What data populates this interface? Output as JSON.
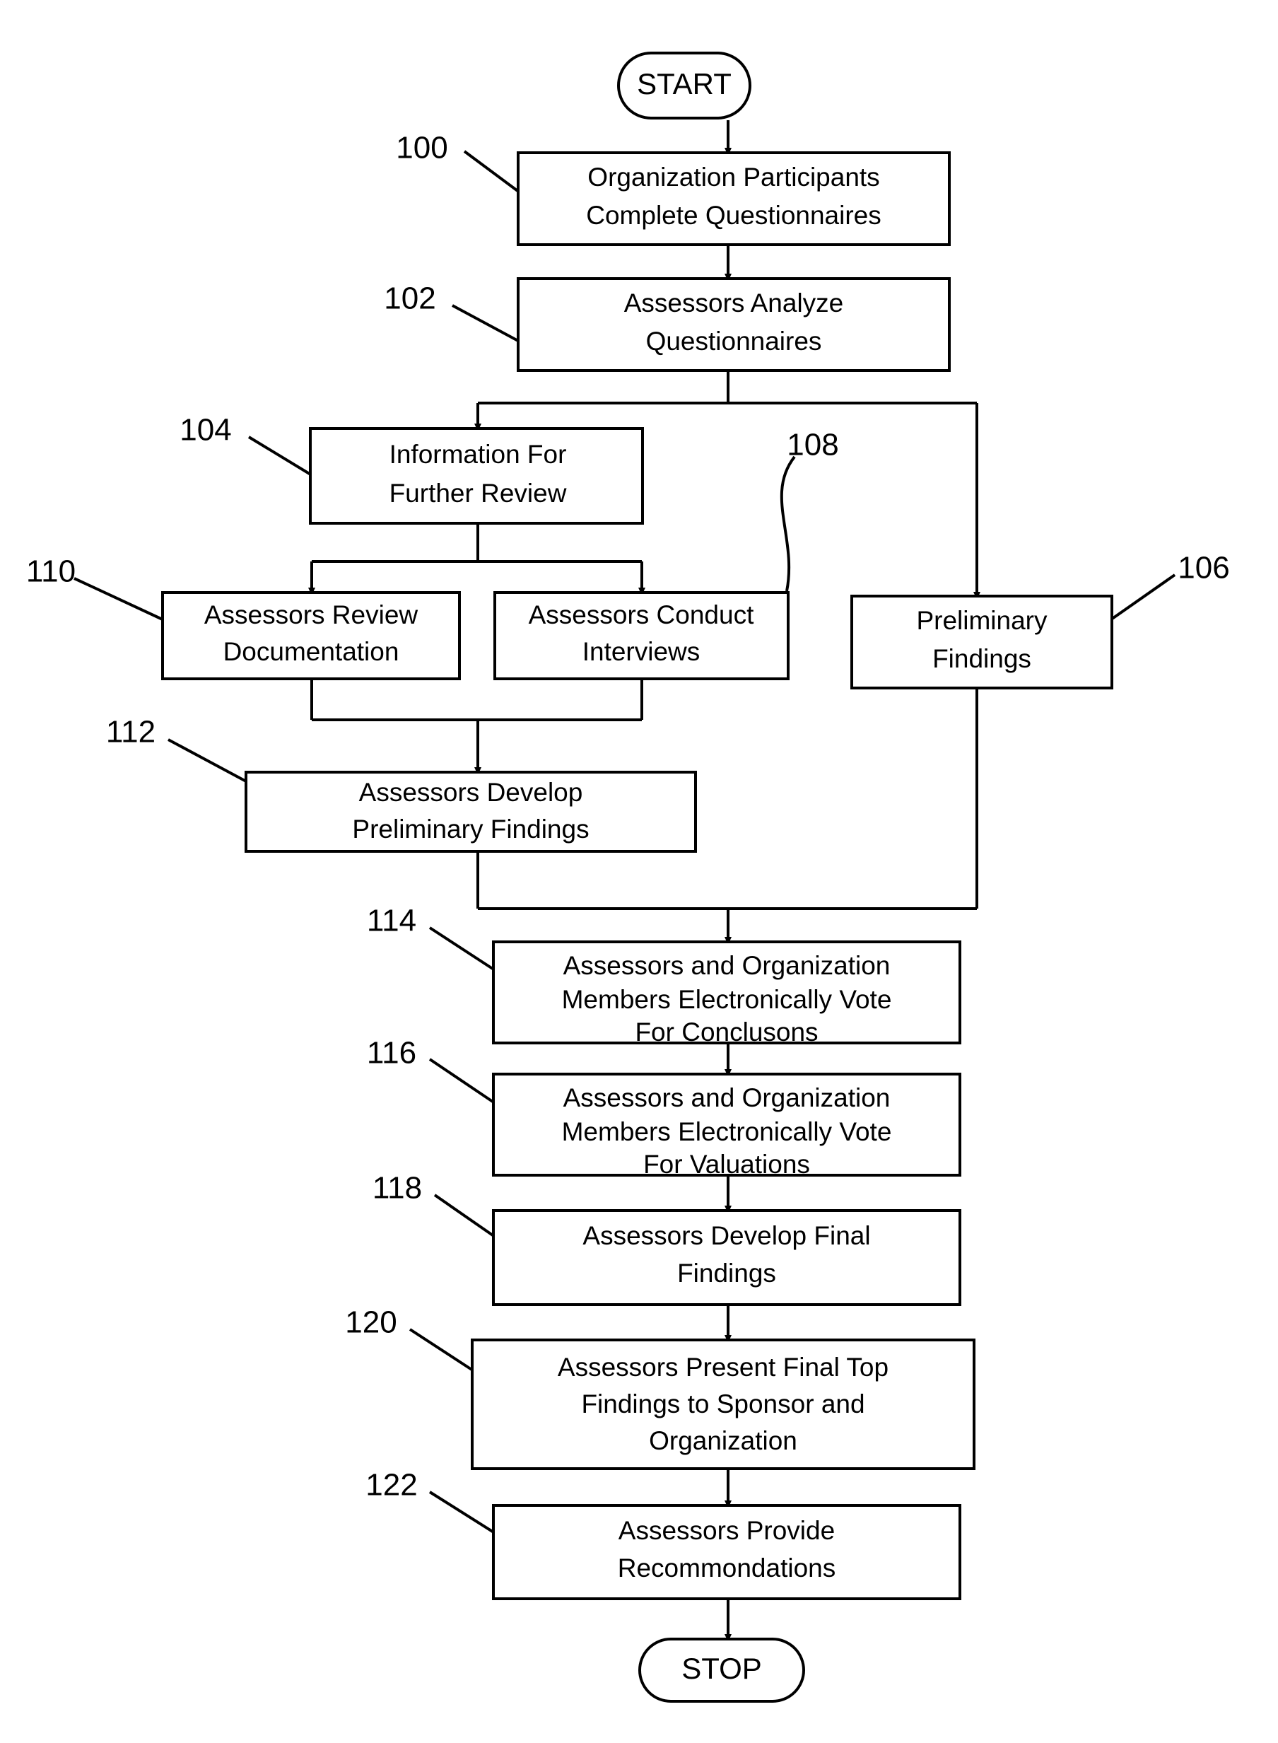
{
  "diagram": {
    "title": "Assessment Process Flowchart",
    "stroke_color": "#000000",
    "fill_color": "#ffffff",
    "terminators": {
      "start": "START",
      "stop": "STOP"
    },
    "nodes": [
      {
        "ref": "100",
        "lines": [
          "Organization Participants",
          "Complete Questionnaires"
        ]
      },
      {
        "ref": "102",
        "lines": [
          "Assessors Analyze",
          "Questionnaires"
        ]
      },
      {
        "ref": "104",
        "lines": [
          "Information For",
          "Further Review"
        ]
      },
      {
        "ref": "110",
        "lines": [
          "Assessors Review",
          "Documentation"
        ]
      },
      {
        "ref": "108",
        "lines": [
          "Assessors Conduct",
          "Interviews"
        ]
      },
      {
        "ref": "106",
        "lines": [
          "Preliminary",
          "Findings"
        ]
      },
      {
        "ref": "112",
        "lines": [
          "Assessors Develop",
          "Preliminary Findings"
        ]
      },
      {
        "ref": "114",
        "lines": [
          "Assessors and Organization",
          "Members Electronically Vote",
          "For Conclusons"
        ]
      },
      {
        "ref": "116",
        "lines": [
          "Assessors and Organization",
          "Members Electronically Vote",
          "For Valuations"
        ]
      },
      {
        "ref": "118",
        "lines": [
          "Assessors Develop Final",
          "Findings"
        ]
      },
      {
        "ref": "120",
        "lines": [
          "Assessors Present Final Top",
          "Findings to Sponsor and",
          "Organization"
        ]
      },
      {
        "ref": "122",
        "lines": [
          "Assessors Provide",
          "Recommondations"
        ]
      }
    ],
    "reference_labels": [
      "100",
      "102",
      "104",
      "108",
      "110",
      "106",
      "112",
      "114",
      "116",
      "118",
      "120",
      "122"
    ]
  }
}
